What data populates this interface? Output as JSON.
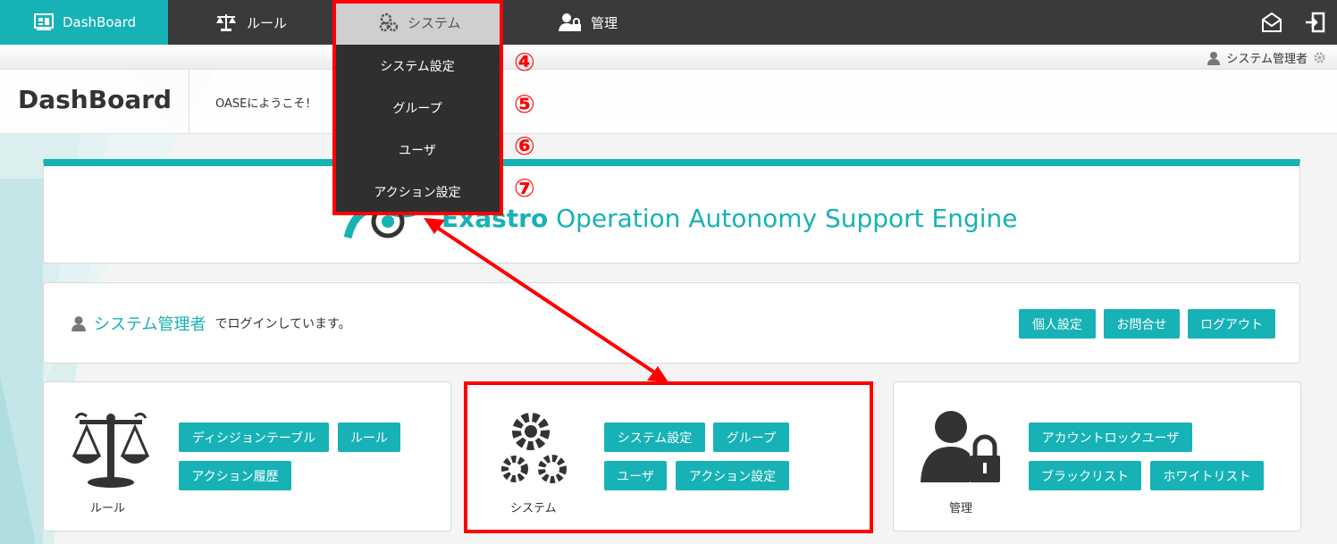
{
  "nav": {
    "dashboard": "DashBoard",
    "rule": "ルール",
    "system": "システム",
    "admin": "管理"
  },
  "header": {
    "user": "システム管理者"
  },
  "page": {
    "title": "DashBoard",
    "welcome": "OASEにようこそ！"
  },
  "dropdown": {
    "items": [
      "システム設定",
      "グループ",
      "ユーザ",
      "アクション設定"
    ],
    "annotations": [
      "④",
      "⑤",
      "⑥",
      "⑦"
    ]
  },
  "banner": {
    "brand": "Exastro",
    "tagline": " Operation Autonomy Support Engine"
  },
  "login": {
    "user": "システム管理者",
    "suffix": "でログインしています。",
    "buttons": [
      "個人設定",
      "お問合せ",
      "ログアウト"
    ]
  },
  "cards": {
    "rule": {
      "label": "ルール",
      "buttons": [
        "ディシジョンテーブル",
        "ルール",
        "アクション履歴"
      ]
    },
    "system": {
      "label": "システム",
      "buttons": [
        "システム設定",
        "グループ",
        "ユーザ",
        "アクション設定"
      ]
    },
    "admin": {
      "label": "管理",
      "buttons": [
        "アカウントロックユーザ",
        "ブラックリスト",
        "ホワイトリスト"
      ]
    }
  },
  "colors": {
    "accent": "#17b2b5",
    "navbar": "#3a3a3a",
    "highlight": "#ff0000"
  }
}
